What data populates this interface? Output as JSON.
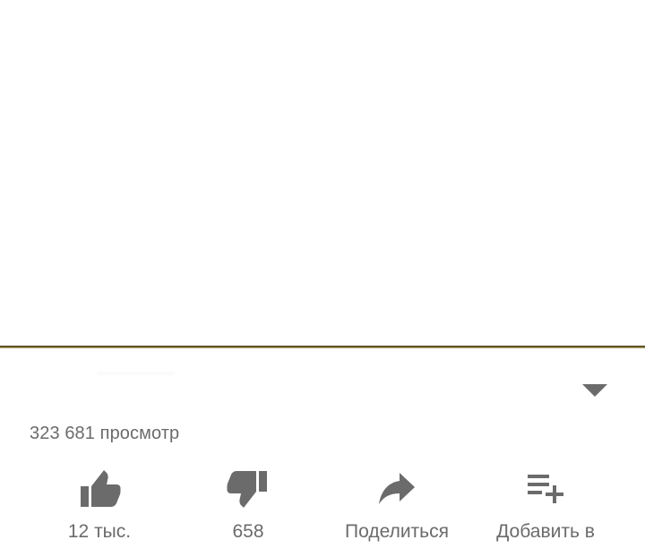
{
  "video": {
    "views_text": "323 681 просмотр"
  },
  "actions": {
    "like_count": "12 тыс.",
    "dislike_count": "658",
    "share_label": "Поделиться",
    "save_label": "Добавить в"
  },
  "icons": {
    "expand": "chevron-down-icon",
    "like": "thumb-up-icon",
    "dislike": "thumb-down-icon",
    "share": "share-arrow-icon",
    "save": "playlist-add-icon"
  },
  "colors": {
    "icon": "#6b6b6b",
    "text": "#6b6b6b",
    "divider": "#8b7a3a",
    "background": "#ffffff"
  }
}
